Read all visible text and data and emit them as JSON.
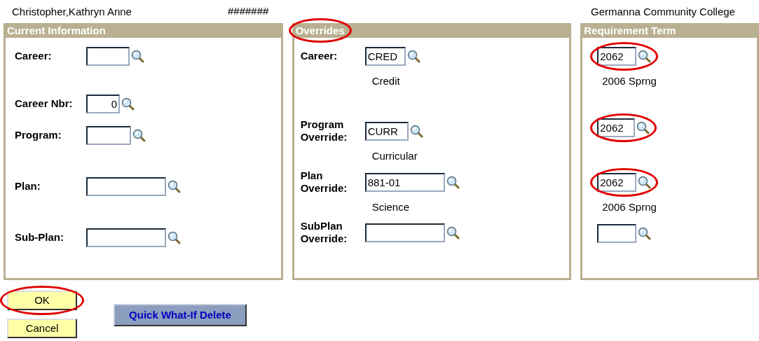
{
  "header": {
    "student_name": "Christopher,Kathryn Anne",
    "id": "#######",
    "institution": "Germanna Community College"
  },
  "panels": [
    {
      "title": "Current Information",
      "highlighted": false,
      "rows": [
        {
          "label": "Career:",
          "value": "",
          "highlighted": false
        },
        {
          "label": "Career Nbr:",
          "value": "0",
          "highlighted": false
        },
        {
          "label": "Program:",
          "value": "",
          "highlighted": false
        },
        {
          "label": "Plan:",
          "value": "",
          "highlighted": false
        },
        {
          "label": "Sub-Plan:",
          "value": "",
          "highlighted": false
        }
      ]
    },
    {
      "title": "Overrides",
      "highlighted": true,
      "rows": [
        {
          "label": "Career:",
          "value": "CRED",
          "description": "Credit",
          "highlighted": false
        },
        {
          "label": "Program Override:",
          "value": "CURR",
          "description": "Curricular",
          "highlighted": false
        },
        {
          "label": "Plan Override:",
          "value": "881-01",
          "description": "Science",
          "highlighted": false
        },
        {
          "label": "SubPlan Override:",
          "value": "",
          "highlighted": false
        }
      ]
    },
    {
      "title": "Requirement Term",
      "highlighted": false,
      "rows": [
        {
          "value": "2062",
          "description": "2006 Sprng",
          "highlighted": true
        },
        {
          "value": "2062",
          "highlighted": true
        },
        {
          "value": "2062",
          "description": "2006 Sprng",
          "highlighted": true
        },
        {
          "value": "",
          "highlighted": false
        }
      ]
    }
  ],
  "buttons": [
    {
      "label": "OK",
      "kind": "action",
      "highlighted": true
    },
    {
      "label": "Cancel",
      "kind": "action",
      "highlighted": false
    },
    {
      "label": "Quick What-If Delete",
      "kind": "command",
      "highlighted": false
    }
  ]
}
